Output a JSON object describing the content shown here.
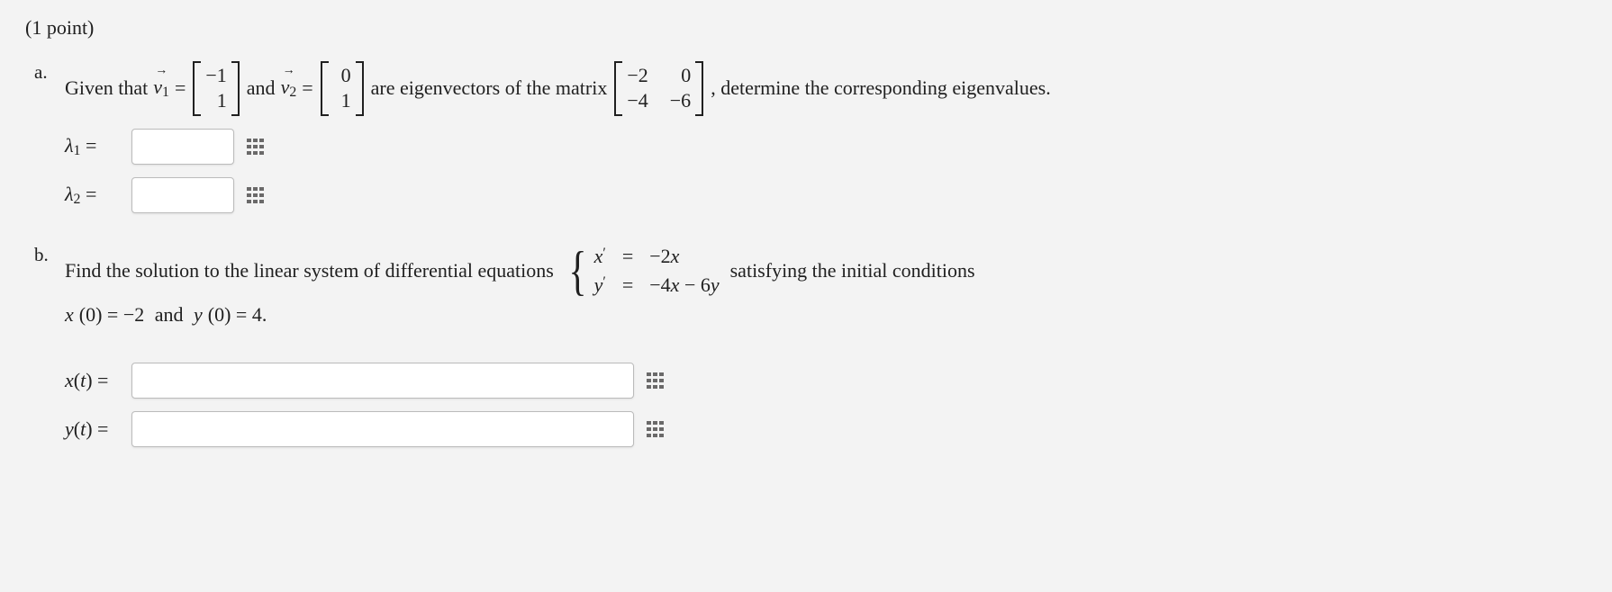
{
  "header": {
    "points_label": "(1 point)"
  },
  "partA": {
    "given_that": "Given that",
    "and": "and",
    "are_eigenvectors": "are eigenvectors of the matrix",
    "determine": ", determine the corresponding eigenvalues.",
    "v1_name": "v",
    "v1_sub": "1",
    "v2_name": "v",
    "v2_sub": "2",
    "eq": "=",
    "v1": [
      "−1",
      "1"
    ],
    "v2": [
      "0",
      "1"
    ],
    "matrix": [
      [
        "−2",
        "0"
      ],
      [
        "−4",
        "−6"
      ]
    ],
    "lambda1_label_sym": "λ",
    "lambda1_label_sub": "1",
    "lambda2_label_sym": "λ",
    "lambda2_label_sub": "2",
    "lambda1_value": "",
    "lambda2_value": ""
  },
  "partB": {
    "find_solution": "Find the solution to the linear system of differential equations",
    "satisfying": "satisfying the initial conditions",
    "sys": {
      "r1": {
        "lhs": "x ′",
        "eq": "=",
        "rhs": "−2x"
      },
      "r2": {
        "lhs": "y ′",
        "eq": "=",
        "rhs": "−4x − 6y"
      }
    },
    "ic_text": "x(0) = −2 and y(0) = 4.",
    "xt_label": "x(t) =",
    "yt_label": "y(t) =",
    "xt_value": "",
    "yt_value": ""
  }
}
